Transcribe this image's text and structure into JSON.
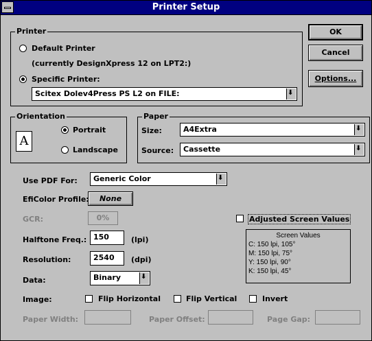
{
  "window": {
    "title": "Printer Setup"
  },
  "buttons": {
    "ok": "OK",
    "cancel": "Cancel",
    "options": "Options..."
  },
  "printer": {
    "legend": "Printer",
    "default_label": "Default Printer",
    "current_text": "(currently DesignXpress 12 on LPT2:)",
    "specific_label": "Specific Printer:",
    "specific_value": "Scitex Dolev4Press PS L2 on FILE:",
    "selected": "specific"
  },
  "orientation": {
    "legend": "Orientation",
    "portrait": "Portrait",
    "landscape": "Landscape",
    "selected": "portrait",
    "icon_letter": "A"
  },
  "paper": {
    "legend": "Paper",
    "size_label": "Size:",
    "size_value": "A4Extra",
    "source_label": "Source:",
    "source_value": "Cassette"
  },
  "pdf": {
    "label": "Use PDF For:",
    "value": "Generic Color"
  },
  "eficolor": {
    "label": "EfiColor Profile:",
    "value": "None"
  },
  "gcr": {
    "label": "GCR:",
    "value": "0%"
  },
  "adjusted": {
    "label": "Adjusted Screen Values",
    "checked": false
  },
  "halftone": {
    "label": "Halftone Freq.:",
    "value": "150",
    "unit": "(lpi)"
  },
  "resolution": {
    "label": "Resolution:",
    "value": "2540",
    "unit": "(dpi)"
  },
  "data": {
    "label": "Data:",
    "value": "Binary"
  },
  "screen_values": {
    "title": "Screen Values",
    "lines": [
      "C: 150 lpi, 105°",
      "M: 150 lpi, 75°",
      "Y: 150 lpi, 90°",
      "K: 150 lpi, 45°"
    ]
  },
  "image": {
    "label": "Image:",
    "flip_h": "Flip Horizontal",
    "flip_v": "Flip Vertical",
    "invert": "Invert"
  },
  "bottom": {
    "paper_width": "Paper Width:",
    "paper_offset": "Paper Offset:",
    "page_gap": "Page Gap:"
  }
}
